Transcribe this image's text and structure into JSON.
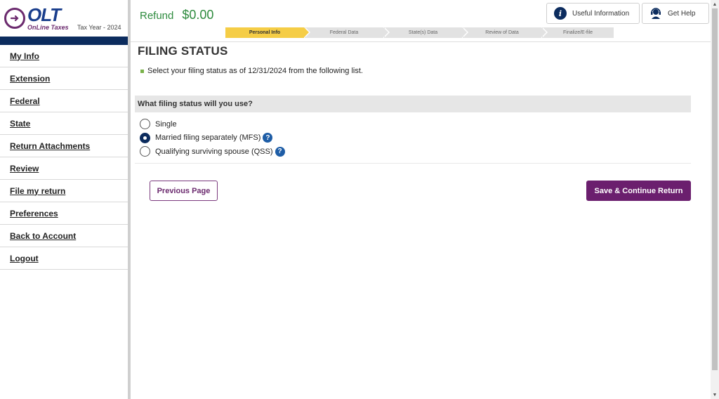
{
  "brand": {
    "logo_text": "OLT",
    "logo_sub": "OnLine Taxes",
    "tax_year": "Tax Year - 2024",
    "color": "#6b2a6e"
  },
  "sidebar": {
    "items": [
      {
        "label": "My Info"
      },
      {
        "label": "Extension"
      },
      {
        "label": "Federal"
      },
      {
        "label": "State"
      },
      {
        "label": "Return Attachments"
      },
      {
        "label": "Review"
      },
      {
        "label": "File my return"
      },
      {
        "label": "Preferences"
      },
      {
        "label": "Back to Account"
      },
      {
        "label": "Logout"
      }
    ]
  },
  "header": {
    "refund_label": "Refund",
    "refund_amount": "$0.00",
    "useful_info_label": "Useful Information",
    "get_help_label": "Get Help",
    "steps": [
      {
        "label": "Personal Info",
        "active": true
      },
      {
        "label": "Federal Data",
        "active": false
      },
      {
        "label": "State(s) Data",
        "active": false
      },
      {
        "label": "Review of Data",
        "active": false
      },
      {
        "label": "Finalize/E-file",
        "active": false
      }
    ]
  },
  "main": {
    "title": "FILING STATUS",
    "instruction": "Select your filing status as of 12/31/2024 from the following list.",
    "question": "What filing status will you use?",
    "options": [
      {
        "label": "Single",
        "checked": false,
        "help": false
      },
      {
        "label": "Married filing separately (MFS)",
        "checked": true,
        "help": true
      },
      {
        "label": "Qualifying surviving spouse (QSS)",
        "checked": false,
        "help": true
      }
    ],
    "prev_button": "Previous Page",
    "save_button": "Save & Continue Return"
  },
  "colors": {
    "accent_purple": "#6b1f6e",
    "nav_navy": "#0c2c5e",
    "refund_green": "#2e8b3e",
    "step_active": "#f5cd46"
  }
}
